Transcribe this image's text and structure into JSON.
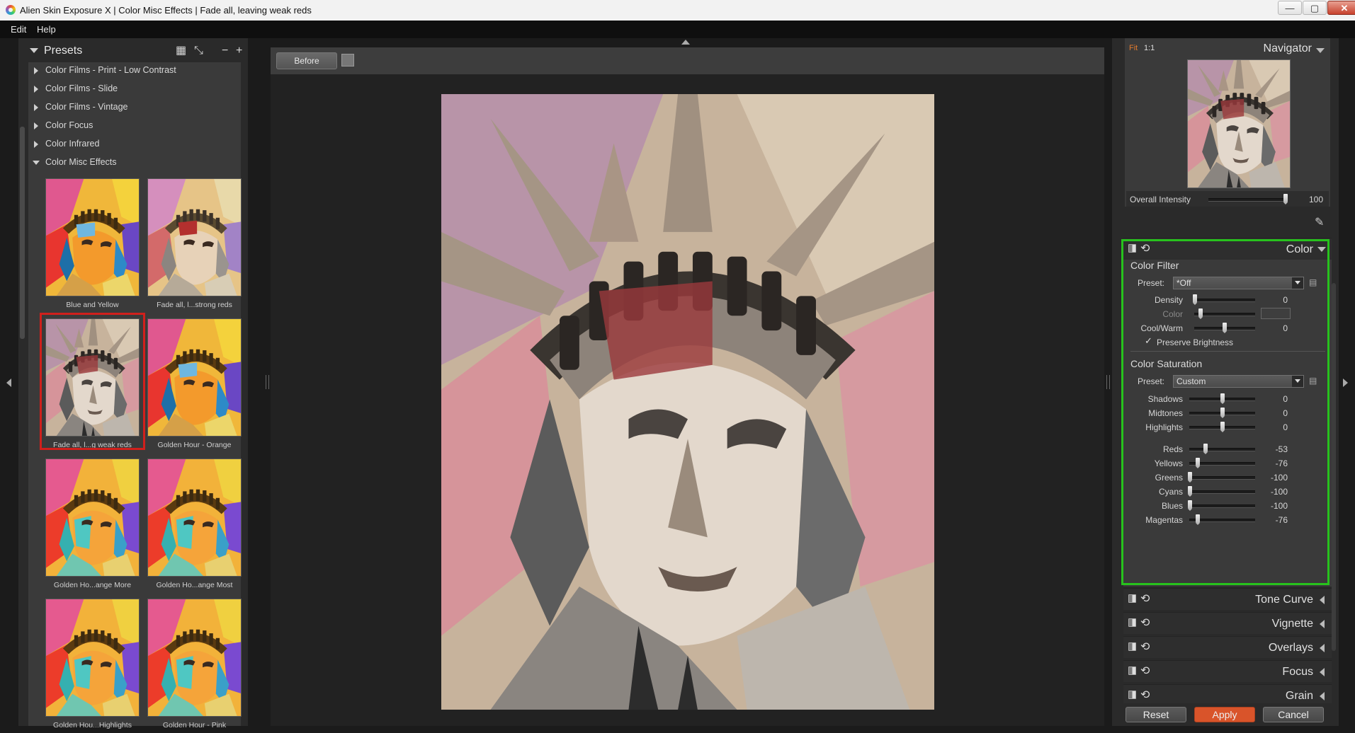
{
  "window": {
    "title": "Alien Skin Exposure X | Color Misc Effects | Fade all, leaving weak reds",
    "controls": [
      "—",
      "▢",
      "✕"
    ]
  },
  "menu": [
    "Edit",
    "Help"
  ],
  "presets": {
    "title": "Presets",
    "categories": [
      {
        "label": "Color Films - Print - Low Contrast"
      },
      {
        "label": "Color Films - Slide"
      },
      {
        "label": "Color Films - Vintage"
      },
      {
        "label": "Color Focus"
      },
      {
        "label": "Color Infrared"
      },
      {
        "label": "Color Misc Effects"
      }
    ],
    "thumbnails": [
      {
        "label": "Blue and Yellow"
      },
      {
        "label": "Fade all, l...strong reds"
      },
      {
        "label": "Fade all, l...g weak reds"
      },
      {
        "label": "Golden Hour - Orange"
      },
      {
        "label": "Golden Ho...ange More"
      },
      {
        "label": "Golden Ho...ange Most"
      },
      {
        "label": "Golden Hou...Highlights"
      },
      {
        "label": "Golden Hour - Pink"
      }
    ]
  },
  "toolbar": {
    "before_label": "Before"
  },
  "navigator": {
    "title": "Navigator",
    "fit": "Fit",
    "one_to_one": "1:1",
    "intensity_label": "Overall Intensity",
    "intensity_value": "100",
    "intensity_level": 1.0
  },
  "color_panel": {
    "title": "Color",
    "filter": {
      "title": "Color Filter",
      "preset_label": "Preset:",
      "preset_value": "*Off",
      "density_label": "Density",
      "density_value": "0",
      "color_label": "Color",
      "coolwarm_label": "Cool/Warm",
      "coolwarm_value": "0",
      "preserve_label": "Preserve Brightness",
      "check": "✓"
    },
    "saturation": {
      "title": "Color Saturation",
      "preset_label": "Preset:",
      "preset_value": "Custom",
      "tones": [
        {
          "label": "Shadows",
          "value": "0"
        },
        {
          "label": "Midtones",
          "value": "0"
        },
        {
          "label": "Highlights",
          "value": "0"
        }
      ],
      "colors": [
        {
          "label": "Reds",
          "value": "-53"
        },
        {
          "label": "Yellows",
          "value": "-76"
        },
        {
          "label": "Greens",
          "value": "-100"
        },
        {
          "label": "Cyans",
          "value": "-100"
        },
        {
          "label": "Blues",
          "value": "-100"
        },
        {
          "label": "Magentas",
          "value": "-76"
        }
      ]
    }
  },
  "sections": [
    {
      "label": "Tone Curve"
    },
    {
      "label": "Vignette"
    },
    {
      "label": "Overlays"
    },
    {
      "label": "Focus"
    },
    {
      "label": "Grain"
    }
  ],
  "buttons": {
    "reset": "Reset",
    "apply": "Apply",
    "cancel": "Cancel"
  },
  "colors": {
    "apply": "#d9542a",
    "highlight_green": "#27c21d",
    "selected_red": "#d0201c"
  }
}
